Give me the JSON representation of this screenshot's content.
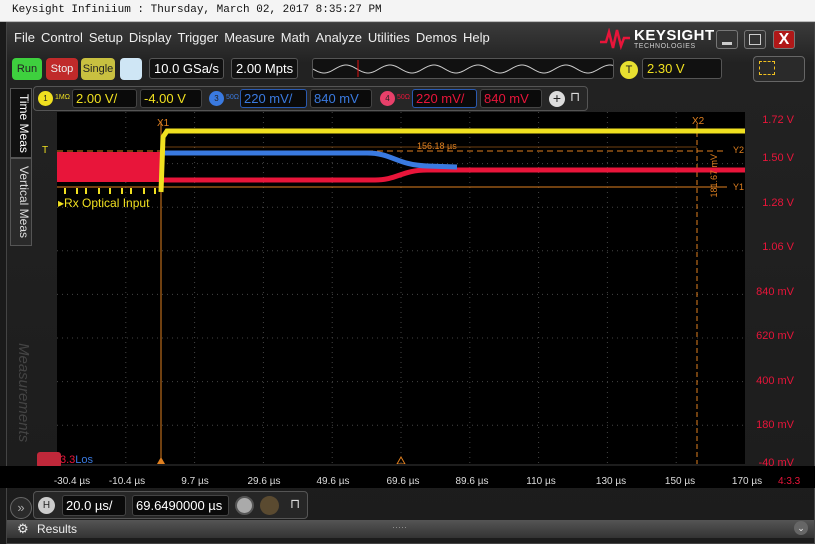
{
  "title_bar": "Keysight Infiniium : Thursday, March 02, 2017 8:35:27 PM",
  "menu": [
    "File",
    "Control",
    "Setup",
    "Display",
    "Trigger",
    "Measure",
    "Math",
    "Analyze",
    "Utilities",
    "Demos",
    "Help"
  ],
  "logo": {
    "brand": "KEYSIGHT",
    "sub": "TECHNOLOGIES"
  },
  "window_buttons": {
    "minimize": "_",
    "maximize": "□",
    "close": "X"
  },
  "toolbar": {
    "run": "Run",
    "stop": "Stop",
    "single": "Single",
    "sample_rate": "10.0 GSa/s",
    "memory_depth": "2.00 Mpts",
    "trigger_badge": "T",
    "trigger_level": "2.30 V"
  },
  "channels": [
    {
      "num": "1",
      "imp": "1MΩ",
      "scale": "2.00 V/",
      "offset": "-4.00 V",
      "color": "#f0e020"
    },
    {
      "num": "3",
      "imp": "50Ω",
      "scale": "220 mV/",
      "offset": "840 mV",
      "color": "#3a7ae0"
    },
    {
      "num": "4",
      "imp": "50Ω",
      "scale": "220 mV/",
      "offset": "840 mV",
      "color": "#e8153a"
    }
  ],
  "side_tabs": [
    "Time Meas",
    "Vertical Meas",
    "Measurements"
  ],
  "y_labels": [
    "1.72 V",
    "1.50 V",
    "1.28 V",
    "1.06 V",
    "840 mV",
    "620 mV",
    "400 mV",
    "180 mV",
    "-40 mV"
  ],
  "x_labels": [
    "-30.4 µs",
    "-10.4 µs",
    "9.7 µs",
    "29.6 µs",
    "49.6 µs",
    "69.6 µs",
    "89.6 µs",
    "110 µs",
    "130 µs",
    "150 µs",
    "170 µs"
  ],
  "corner_label": "4:3.3",
  "plot": {
    "label_ch1": "Rx Optical Input",
    "trigger_marker": "T",
    "cursor_x1": "X1",
    "cursor_x2": "X2",
    "cursor_y1": "Y1",
    "cursor_y2": "Y2",
    "delta_x": "156.18 µs",
    "delta_y": "181.67 mV",
    "ch4_label_a": "3.3",
    "ch4_label_b": "Los"
  },
  "horizontal": {
    "badge": "H",
    "scale": "20.0 µs/",
    "position": "69.6490000 µs"
  },
  "results": {
    "label": "Results"
  }
}
